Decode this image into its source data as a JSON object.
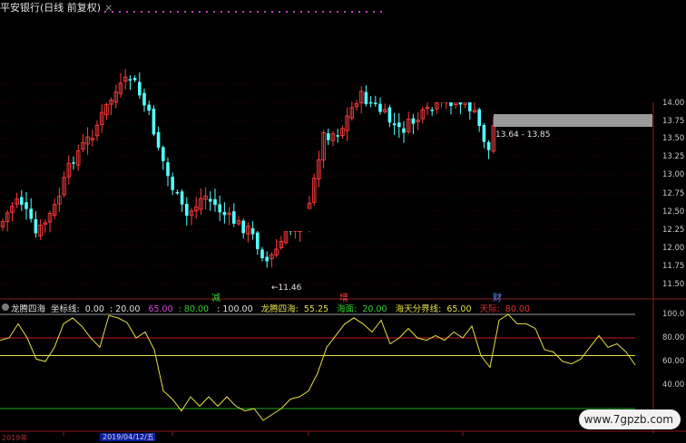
{
  "header": {
    "title": "平安银行(日线 前复权)",
    "close_symbol": "×"
  },
  "price_axis": {
    "labels": [
      "14.00",
      "13.75",
      "13.50",
      "13.25",
      "13.00",
      "12.75",
      "12.50",
      "12.25",
      "12.00",
      "11.75",
      "11.50"
    ]
  },
  "annotations": {
    "low_price": "←11.46",
    "range_text": "13.64 - 13.85",
    "marker_jian": "减",
    "marker_zeng": "增",
    "marker_cai": "财"
  },
  "indicator": {
    "name": "龙腾四海",
    "coord_label": "坐标线:",
    "coord_values": [
      "0.00",
      "20.00",
      "65.00",
      "80.00",
      "100.00"
    ],
    "value_label": "龙腾四海:",
    "value": "55.25",
    "hai_mian_label": "海面:",
    "hai_mian_value": "20.00",
    "boundary_label": "海天分界线:",
    "boundary_value": "65.00",
    "sky_label": "天际:",
    "sky_value": "80.00",
    "axis_labels": [
      "100.0",
      "80.00",
      "60.00",
      "40.00"
    ]
  },
  "time_axis": {
    "year_label": "2019年",
    "selected_date": "2019/04/12/五"
  },
  "watermark": "www.7gpzb.com",
  "colors": {
    "up": "#ff3c3c",
    "down": "#54ffff",
    "oscillator": "#e6e04a",
    "sky_line": "#c81e1e",
    "boundary_line": "#e6e04a",
    "sea_line": "#1fa81f"
  }
}
